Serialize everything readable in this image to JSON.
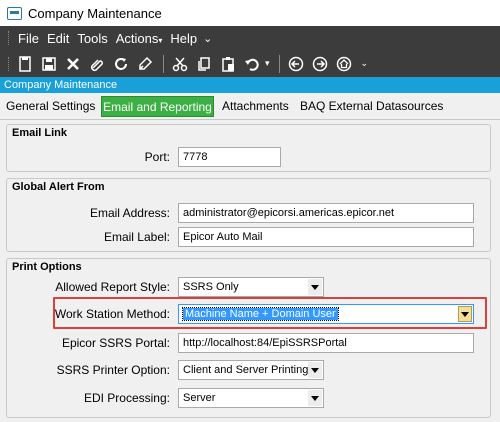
{
  "window": {
    "title": "Company Maintenance"
  },
  "menu": [
    "File",
    "Edit",
    "Tools",
    "Actions",
    "Help"
  ],
  "toolbar_icons": [
    "save-disk-icon",
    "save-icon",
    "delete-icon",
    "attach-icon",
    "refresh-icon",
    "clear-icon",
    "cut-icon",
    "copy-icon",
    "paste-icon",
    "undo-icon",
    "back-icon",
    "forward-icon",
    "home-icon"
  ],
  "header": {
    "label": "Company Maintenance"
  },
  "tabs": {
    "general": "General Settings",
    "email": "Email and Reporting",
    "attachments": "Attachments",
    "baq": "BAQ External Datasources"
  },
  "email_link": {
    "title": "Email Link",
    "port_label": "Port:",
    "port_value": "7778"
  },
  "global_alert": {
    "title": "Global Alert From",
    "address_label": "Email Address:",
    "address_value": "administrator@epicorsi.americas.epicor.net",
    "email_label_label": "Email Label:",
    "email_label_value": "Epicor Auto Mail"
  },
  "print_options": {
    "title": "Print Options",
    "report_style_label": "Allowed Report Style:",
    "report_style_value": "SSRS Only",
    "wsm_label": "Work Station Method:",
    "wsm_value": "Machine Name + Domain User",
    "ssrs_portal_label": "Epicor SSRS Portal:",
    "ssrs_portal_value": "http://localhost:84/EpiSSRSPortal",
    "printer_option_label": "SSRS Printer Option:",
    "printer_option_value": "Client and Server Printing",
    "edi_label": "EDI Processing:",
    "edi_value": "Server"
  }
}
